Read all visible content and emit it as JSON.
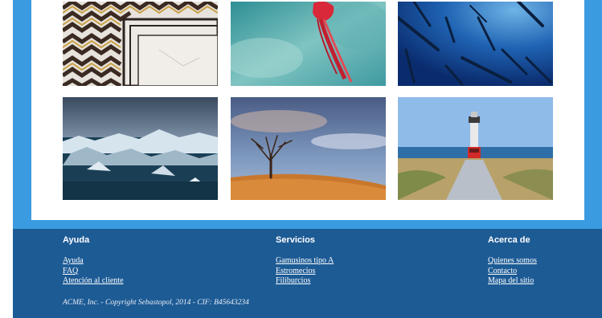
{
  "gallery": {
    "images": [
      {
        "icon": "marble-floor-image"
      },
      {
        "icon": "jellyfish-image"
      },
      {
        "icon": "fish-school-image"
      },
      {
        "icon": "icebergs-image"
      },
      {
        "icon": "lone-tree-image"
      },
      {
        "icon": "lighthouse-road-image"
      }
    ]
  },
  "footer": {
    "columns": [
      {
        "title": "Ayuda",
        "links": [
          "Ayuda",
          "FAQ",
          "Atención al cliente"
        ]
      },
      {
        "title": "Servicios",
        "links": [
          "Gamusinos tipo A",
          "Estromecios",
          "Filiburcios"
        ]
      },
      {
        "title": "Acerca de",
        "links": [
          "Quienes somos",
          "Contacto",
          "Mapa del sitio"
        ]
      }
    ],
    "copyright": "ACME, Inc. - Copyright Sebastopol, 2014 - CIF: B45643234"
  },
  "colors": {
    "frame_blue": "#3b9be0",
    "footer_blue": "#1d5b95"
  }
}
